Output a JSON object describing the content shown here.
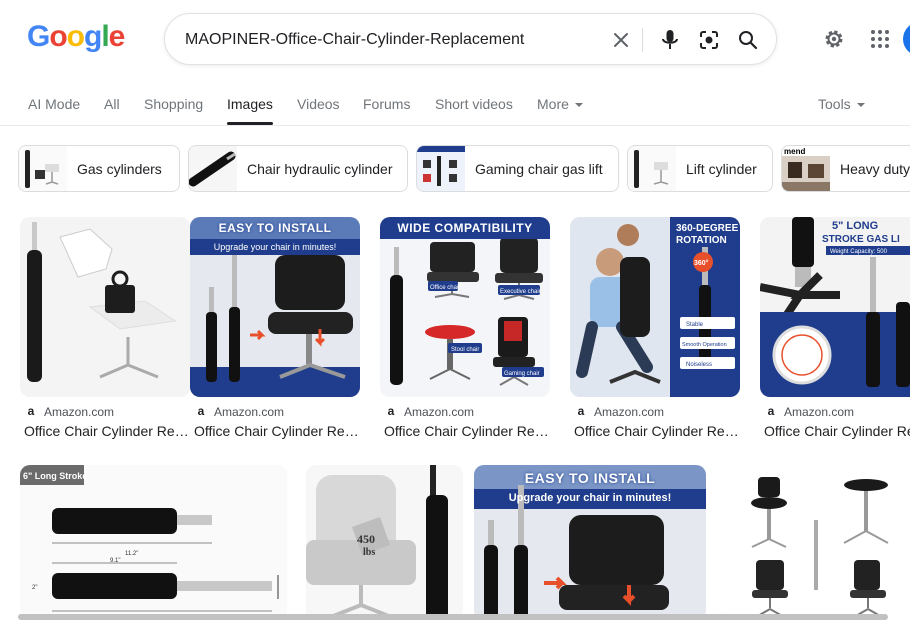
{
  "logo": {
    "letters": [
      "G",
      "o",
      "o",
      "g",
      "l",
      "e"
    ],
    "colors": [
      "#4285f4",
      "#ea4335",
      "#fbbc05",
      "#4285f4",
      "#34a853",
      "#ea4335"
    ]
  },
  "search": {
    "value": "MAOPINER-Office-Chair-Cylinder-Replacement"
  },
  "icons": {
    "clear": "close-icon",
    "voice": "microphone-icon",
    "lens": "camera-lens-icon",
    "search": "search-icon",
    "settings": "gear-icon",
    "apps": "apps-grid-icon"
  },
  "tabs": {
    "ai_mode": "AI Mode",
    "all": "All",
    "shopping": "Shopping",
    "images": "Images",
    "videos": "Videos",
    "forums": "Forums",
    "short_videos": "Short videos",
    "more": "More",
    "tools": "Tools"
  },
  "chips": [
    "Gas cylinders",
    "Chair hydraulic cylinder",
    "Gaming chair gas lift",
    "Lift cylinder",
    "Heavy duty"
  ],
  "chip_thumbs": {
    "heavy_duty_text": "mend"
  },
  "results": [
    {
      "source": "Amazon.com",
      "title": "Office Chair Cylinder Replacement"
    },
    {
      "source": "Amazon.com",
      "title": "Office Chair Cylinder Replacement",
      "banner": "EASY TO INSTALL",
      "subbanner": "Upgrade your chair in minutes!"
    },
    {
      "source": "Amazon.com",
      "title": "Office Chair Cylinder Replacement",
      "banner": "WIDE COMPATIBILITY",
      "labels": [
        "Office chair",
        "Executive chair",
        "Stool chair",
        "Gaming chair"
      ]
    },
    {
      "source": "Amazon.com",
      "title": "Office Chair Cylinder Replacement",
      "banner_line1": "360-DEGREE",
      "banner_line2": "ROTATION",
      "badge": "360°",
      "labels": [
        "Stable",
        "Smooth Operation",
        "Noiseless"
      ]
    },
    {
      "source": "Amazon.com",
      "title": "Office Chair Cylinder Replacement",
      "banner_line1": "5\" LONG",
      "banner_line2": "STROKE GAS LI",
      "subbanner": "Weight Capacity: 500"
    }
  ],
  "row2": [
    {
      "tag": "6\" Long Stroke",
      "dims": [
        "11.2\"",
        "9.1\"",
        "2\""
      ]
    },
    {
      "badge_line1": "450",
      "badge_line2": "lbs"
    },
    {
      "banner": "EASY TO INSTALL",
      "subbanner": "Upgrade your chair in minutes!"
    },
    {}
  ],
  "colors": {
    "accent": "#1a73e8",
    "banner_blue": "#1f3d8c",
    "amazon_red": "#e8502c"
  }
}
